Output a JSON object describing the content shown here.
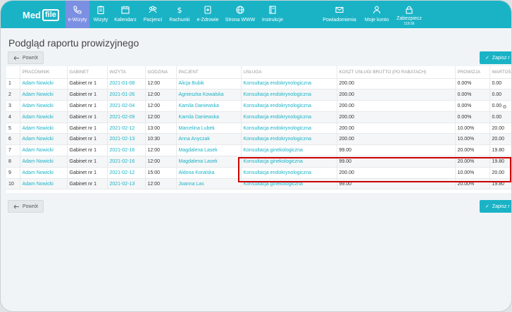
{
  "app": {
    "logo_text": "Med",
    "logo_box": "file"
  },
  "nav": {
    "items": [
      {
        "label": "e-Wizyty",
        "icon": "phone-icon"
      },
      {
        "label": "Wizyty",
        "icon": "clipboard-icon"
      },
      {
        "label": "Kalendarz",
        "icon": "calendar-icon"
      },
      {
        "label": "Pacjenci",
        "icon": "users-icon"
      },
      {
        "label": "Rachunki",
        "icon": "dollar-icon"
      },
      {
        "label": "e-Zdrowie",
        "icon": "health-icon"
      },
      {
        "label": "Strona WWW",
        "icon": "globe-icon"
      },
      {
        "label": "Instrukcje",
        "icon": "book-icon"
      },
      {
        "label": "Powiadomienia",
        "icon": "mail-icon"
      },
      {
        "label": "Moje konto",
        "icon": "user-icon"
      },
      {
        "label": "Zabezpiecz",
        "icon": "lock-icon",
        "sub": "119:36"
      }
    ]
  },
  "page": {
    "title": "Podgląd raportu prowizyjnego",
    "back_label": "Powrót",
    "save_label": "Zapisz r"
  },
  "table": {
    "headers": [
      "",
      "PRACOWNIK",
      "GABINET",
      "WIZYTA",
      "GODZINA",
      "PACJENT",
      "USŁUGA",
      "KOSZT USŁUGI BRUTTO (PO RABATACH)",
      "PROWIZJA",
      "WARTOŚ"
    ],
    "rows": [
      [
        "1",
        "Adam Nowicki",
        "Gabinet nr 1",
        "2021-01-08",
        "12:00",
        "Alicja Bubik",
        "Konsultacja endokrynologiczna",
        "200.00",
        "0.00%",
        "0.00"
      ],
      [
        "2",
        "Adam Nowicki",
        "Gabinet nr 1",
        "2021-01-26",
        "12:00",
        "Agnieszka Kowalska",
        "Konsultacja endokrynologiczna",
        "200.00",
        "0.00%",
        "0.00"
      ],
      [
        "3",
        "Adam Nowicki",
        "Gabinet nr 1",
        "2021-02-04",
        "12:00",
        "Kamila Daniewska",
        "Konsultacja endokrynologiczna",
        "200.00",
        "0.00%",
        "0.00"
      ],
      [
        "4",
        "Adam Nowicki",
        "Gabinet nr 1",
        "2021-02-09",
        "12:00",
        "Kamila Daniewska",
        "Konsultacja endokrynologiczna",
        "200.00",
        "0.00%",
        "0.00"
      ],
      [
        "5",
        "Adam Nowicki",
        "Gabinet nr 1",
        "2021-02-12",
        "13:00",
        "Marcelina Lubek",
        "Konsultacja endokrynologiczna",
        "200.00",
        "10.00%",
        "20.00"
      ],
      [
        "6",
        "Adam Nowicki",
        "Gabinet nr 1",
        "2021-02-13",
        "10:30",
        "Anna Anyczak",
        "Konsultacja endokrynologiczna",
        "200.00",
        "10.00%",
        "20.00"
      ],
      [
        "7",
        "Adam Nowicki",
        "Gabinet nr 1",
        "2021-02-16",
        "12:00",
        "Magdalena Lasek",
        "Konsultacja ginekologiczna",
        "99.00",
        "20.00%",
        "19.80"
      ],
      [
        "8",
        "Adam Nowicki",
        "Gabinet nr 1",
        "2021-02-16",
        "12:00",
        "Magdalena Lasek",
        "Konsultacja ginekologiczna",
        "99.00",
        "20.00%",
        "19.80"
      ],
      [
        "9",
        "Adam Nowicki",
        "Gabinet nr 1",
        "2021-02-12",
        "15:00",
        "Aldona Koralska",
        "Konsultacja endokrynologiczna",
        "200.00",
        "10.00%",
        "20.00"
      ],
      [
        "10",
        "Adam Nowicki",
        "Gabinet nr 1",
        "2021-02-13",
        "12:00",
        "Joanna Las",
        "Konsultacja ginekologiczna",
        "99.00",
        "20.00%",
        "19.80"
      ]
    ]
  },
  "colors": {
    "accent": "#1ab3c6",
    "active_nav": "#7b8fe3",
    "highlight": "#cc0000"
  }
}
